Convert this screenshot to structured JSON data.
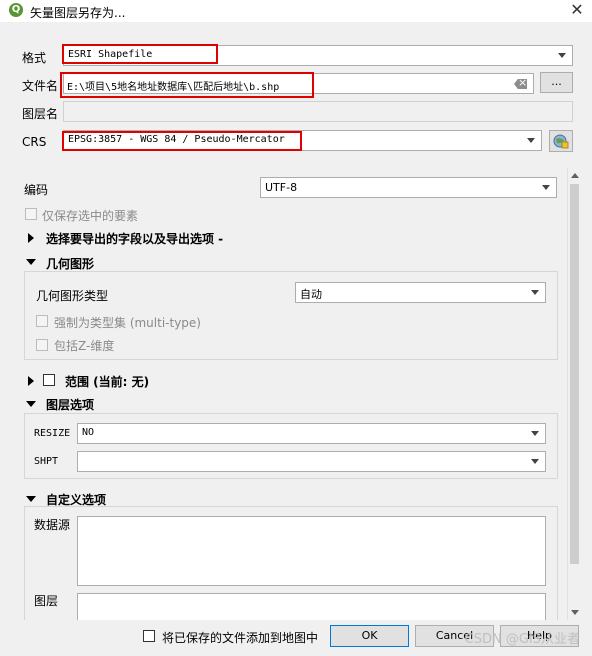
{
  "window": {
    "title": "矢量图层另存为...",
    "app_icon": "qgis-icon",
    "close_icon": "close-icon"
  },
  "form": {
    "format": {
      "label": "格式",
      "value": "ESRI Shapefile"
    },
    "filename": {
      "label": "文件名",
      "value": "E:\\项目\\5地名地址数据库\\匹配后地址\\b.shp",
      "browse_label": "..."
    },
    "layername": {
      "label": "图层名",
      "value": ""
    },
    "crs": {
      "label": "CRS",
      "value": "EPSG:3857 - WGS 84 / Pseudo-Mercator"
    }
  },
  "options": {
    "encoding": {
      "label": "编码",
      "value": "UTF-8"
    },
    "selected_only": {
      "label": "仅保存选中的要素",
      "checked": false
    },
    "select_fields": {
      "label": "选择要导出的字段以及导出选项 -"
    },
    "geometry": {
      "header": "几何图形",
      "type_label": "几何图形类型",
      "type_value": "自动",
      "force_multi": "强制为类型集 (multi-type)",
      "include_z": "包括Z-维度"
    },
    "extent": {
      "label": "范围 (当前: 无)"
    },
    "layer_options": {
      "header": "图层选项",
      "resize_label": "RESIZE",
      "resize_value": "NO",
      "shpt_label": "SHPT",
      "shpt_value": ""
    },
    "custom_options": {
      "header": "自定义选项",
      "datasource_label": "数据源",
      "layer_label": "图层"
    }
  },
  "footer": {
    "add_to_map": "将已保存的文件添加到地图中",
    "ok": "OK",
    "cancel": "Cancel",
    "help": "Help"
  },
  "watermark": "CSDN @GIS从业者",
  "colors": {
    "highlight": "#e00000",
    "qgis_green": "#589632"
  }
}
